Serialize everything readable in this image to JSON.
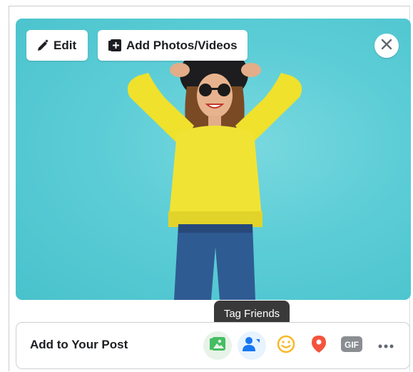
{
  "photo": {
    "edit_label": "Edit",
    "add_label": "Add Photos/Videos"
  },
  "tooltip": {
    "text": "Tag Friends"
  },
  "add_to_post": {
    "label": "Add to Your Post",
    "tools": [
      {
        "name": "photo-video",
        "icon": "photo-icon",
        "color": "#45bd62"
      },
      {
        "name": "tag-friends",
        "icon": "tag-people-icon",
        "color": "#1877f2"
      },
      {
        "name": "feeling",
        "icon": "smiley-icon",
        "color": "#f7b928"
      },
      {
        "name": "check-in",
        "icon": "location-pin-icon",
        "color": "#f5533d"
      },
      {
        "name": "gif",
        "icon": "gif-icon",
        "color": "#8a8d91",
        "text": "GIF"
      },
      {
        "name": "more",
        "icon": "more-icon",
        "color": "#606770"
      }
    ]
  }
}
